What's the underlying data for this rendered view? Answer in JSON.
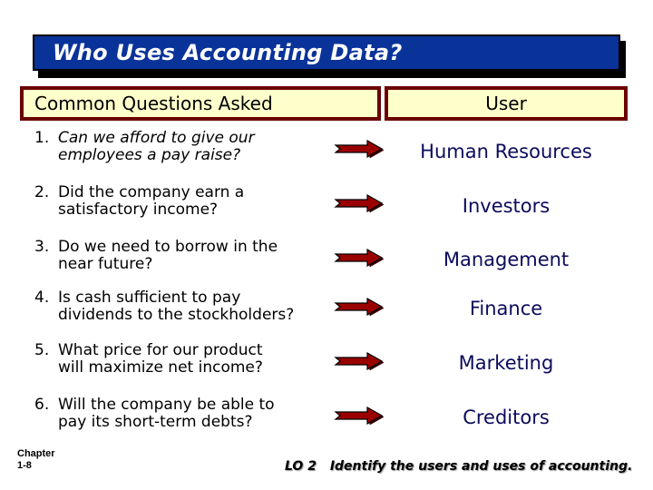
{
  "slide": {
    "title": "Who Uses Accounting Data?",
    "headers": {
      "questions": "Common Questions Asked",
      "user": "User"
    },
    "rows": [
      {
        "number": "1.",
        "question_line1": "Can we afford to give our",
        "question_line2": "employees a pay raise?",
        "user": "Human Resources",
        "icon": "right-arrow-icon"
      },
      {
        "number": "2.",
        "question_line1": "Did the company earn a",
        "question_line2": "satisfactory income?",
        "user": "Investors",
        "icon": "right-arrow-icon"
      },
      {
        "number": "3.",
        "question_line1": "Do we need to borrow in the",
        "question_line2": "near future?",
        "user": "Management",
        "icon": "right-arrow-icon"
      },
      {
        "number": "4.",
        "question_line1": "Is cash sufficient to pay",
        "question_line2": "dividends to the stockholders?",
        "user": "Finance",
        "icon": "right-arrow-icon"
      },
      {
        "number": "5.",
        "question_line1": "What price for our product",
        "question_line2": "will maximize net income?",
        "user": "Marketing",
        "icon": "right-arrow-icon"
      },
      {
        "number": "6.",
        "question_line1": "Will the company be able to",
        "question_line2": "pay its short-term debts?",
        "user": "Creditors",
        "icon": "right-arrow-icon"
      }
    ],
    "footer": {
      "chapter_label": "Chapter",
      "chapter_page": "1-8",
      "lo_number": "LO 2",
      "lo_text": "Identify the users and uses of accounting."
    },
    "colors": {
      "title_bar": "#0a3399",
      "header_fill": "#ffffcc",
      "header_border": "#6b0000",
      "arrow": "#9b0000",
      "user_text": "#0b0b5c"
    }
  }
}
